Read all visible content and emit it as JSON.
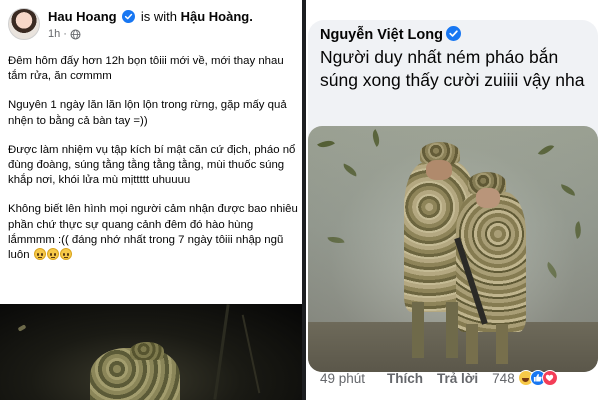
{
  "left_post": {
    "author_name": "Hau Hoang",
    "with_text": "is with",
    "tagged_name": "Hậu Hoàng.",
    "time": "1h",
    "paragraphs": [
      "Đêm hôm đấy hơn 12h bọn tôiii mới về, mới thay nhau tắm rửa, ăn cơmmm",
      "Nguyên 1 ngày lăn lăn lộn lộn trong rừng, gặp mấy quả nhện to bằng cả bàn tay =))",
      "Được làm nhiệm vụ tập kích bí mật căn cứ địch, pháo nổ đùng đoàng, súng tằng tằng tằng tằng, mùi thuốc súng khắp nơi, khói lửa mù mịttttt uhuuuu",
      "Không biết lên hình mọi người cảm nhận được bao nhiêu phần chứ thực sự quang cảnh đêm đó hào hùng lắmmmm :(( đáng nhớ nhất trong 7 ngày tôiii nhập ngũ luôn"
    ]
  },
  "right_comment": {
    "author_name": "Nguyễn Việt Long",
    "text": "Người duy nhất ném pháo bắn súng xong thấy cười zuiiii vậy nha",
    "time": "49 phút",
    "like_label": "Thích",
    "reply_label": "Trả lời",
    "reaction_count": "748",
    "reactions": [
      "haha-icon",
      "like-icon",
      "love-icon"
    ]
  },
  "colors": {
    "verified_blue": "#1877f2",
    "meta_gray": "#65676b",
    "comment_bubble": "#f0f2f5",
    "divider": "#1c1e21"
  }
}
